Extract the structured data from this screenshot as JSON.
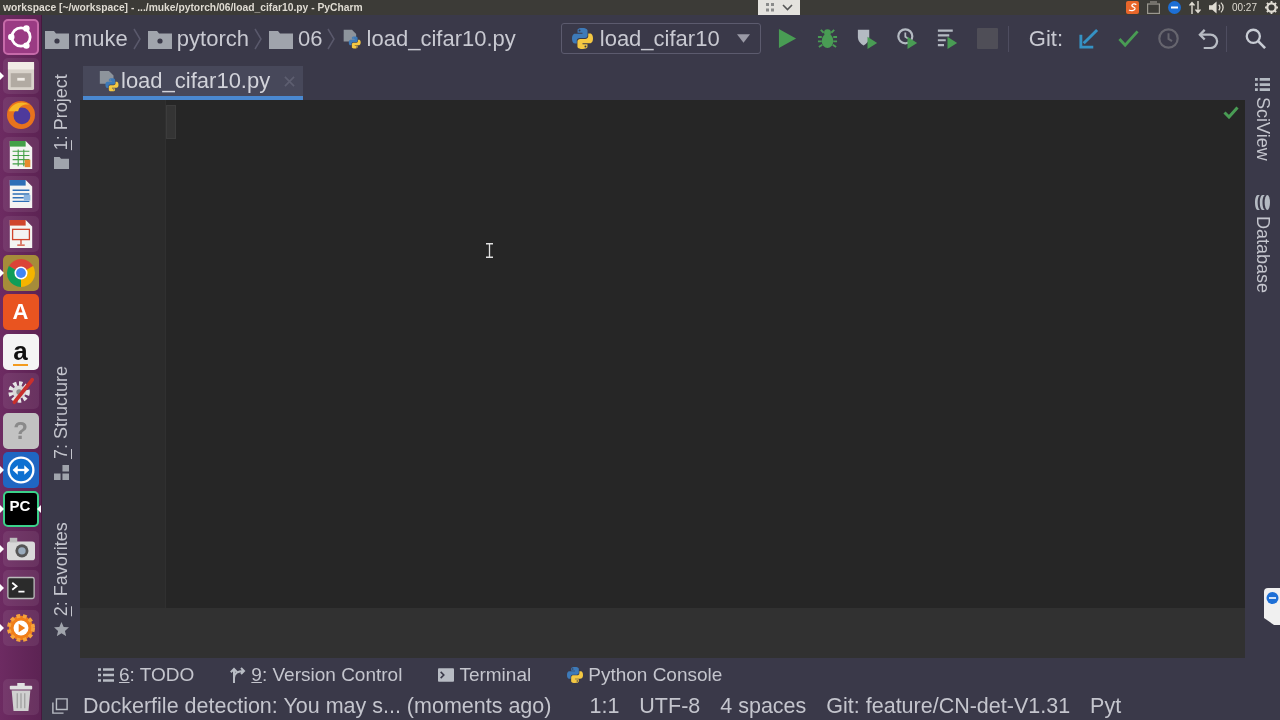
{
  "window": {
    "title": "workspace [~/workspace] - .../muke/pytorch/06/load_cifar10.py - PyCharm"
  },
  "top_panel": {
    "clock": "00:27"
  },
  "launcher": [
    {
      "kind": "dash",
      "running": false,
      "selected": false
    },
    {
      "kind": "files",
      "running": true,
      "selected": false
    },
    {
      "kind": "browser",
      "running": false,
      "selected": false
    },
    {
      "kind": "spreadsheet",
      "running": false,
      "selected": false
    },
    {
      "kind": "document",
      "running": false,
      "selected": false
    },
    {
      "kind": "presentation",
      "running": false,
      "selected": false
    },
    {
      "kind": "web",
      "running": true,
      "selected": false
    },
    {
      "kind": "store",
      "glyph": "A",
      "running": false,
      "selected": false
    },
    {
      "kind": "shop",
      "glyph": "a",
      "running": false,
      "selected": false
    },
    {
      "kind": "settings",
      "running": false,
      "selected": false
    },
    {
      "kind": "help",
      "glyph": "?",
      "running": false,
      "selected": false
    },
    {
      "kind": "remote",
      "running": true,
      "selected": false
    },
    {
      "kind": "ide",
      "glyph": "PC",
      "running": true,
      "selected": true
    },
    {
      "kind": "camera",
      "running": true,
      "selected": false
    },
    {
      "kind": "terminal",
      "running": true,
      "selected": false
    },
    {
      "kind": "media",
      "running": true,
      "selected": false
    },
    {
      "kind": "trash",
      "running": false,
      "selected": false
    }
  ],
  "navigation": {
    "breadcrumbs": [
      {
        "kind": "module-folder",
        "label": "muke"
      },
      {
        "kind": "module-folder",
        "label": "pytorch"
      },
      {
        "kind": "folder",
        "label": "06"
      },
      {
        "kind": "python-file",
        "label": "load_cifar10.py"
      }
    ]
  },
  "run_config": {
    "label": "load_cifar10"
  },
  "run_actions": [
    {
      "kind": "run",
      "disabled": false
    },
    {
      "kind": "debug",
      "disabled": false
    },
    {
      "kind": "coverage",
      "disabled": false
    },
    {
      "kind": "profile",
      "disabled": false
    },
    {
      "kind": "concurrency",
      "disabled": false
    },
    {
      "kind": "stop",
      "disabled": true
    }
  ],
  "git": {
    "label": "Git:",
    "actions": [
      {
        "kind": "update",
        "disabled": false
      },
      {
        "kind": "commit",
        "disabled": false
      },
      {
        "kind": "history",
        "disabled": true
      },
      {
        "kind": "rollback",
        "disabled": false
      }
    ]
  },
  "left_stripe": {
    "top": [
      {
        "mnemonic": "1",
        "label": ": Project",
        "kind": "project"
      }
    ],
    "bottom": [
      {
        "mnemonic": "7",
        "label": ": Structure",
        "kind": "structure"
      },
      {
        "mnemonic": "2",
        "label": ": Favorites",
        "kind": "favorites"
      }
    ]
  },
  "right_stripe": [
    {
      "label": "SciView",
      "kind": "sciview"
    },
    {
      "label": "Database",
      "kind": "database"
    }
  ],
  "tabs": [
    {
      "label": "load_cifar10.py",
      "kind": "python-file",
      "selected": true
    }
  ],
  "editor": {
    "no_problems": true
  },
  "tool_windows": [
    {
      "mnemonic": "6",
      "label": ": TODO",
      "kind": "todo"
    },
    {
      "mnemonic": "9",
      "label": ": Version Control",
      "kind": "vcs"
    },
    {
      "label": "Terminal",
      "kind": "terminal"
    },
    {
      "label": "Python Console",
      "kind": "console"
    }
  ],
  "status_bar": {
    "message": "Dockerfile detection: You may s... (moments ago)",
    "widgets": [
      "1:1",
      "UTF-8",
      "4 spaces",
      "Git: feature/CN-det-V1.31",
      "Pyt"
    ]
  }
}
